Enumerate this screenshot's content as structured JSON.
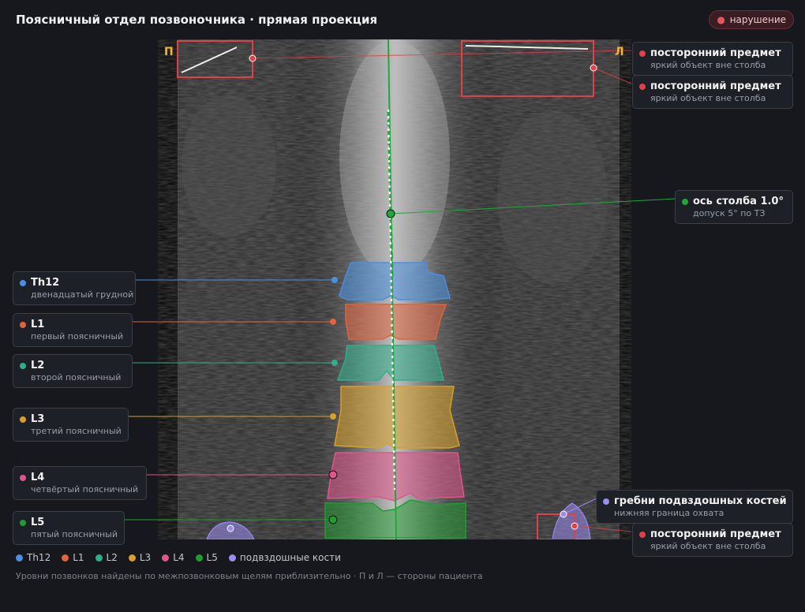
{
  "header": {
    "title": "Поясничный отдел позвоночника · прямая проекция",
    "badge": "нарушение"
  },
  "sides": {
    "right": "П",
    "left": "Л"
  },
  "colors": {
    "Th12": "#4a8fe0",
    "L1": "#e0643c",
    "L2": "#2fae8a",
    "L3": "#d8a028",
    "L4": "#e0558c",
    "L5": "#1e9e2e",
    "iliac": "#9b8cf0",
    "foreign": "#e0404a",
    "axis": "#1ea83a"
  },
  "foreign_objects": [
    {
      "name": "посторонний предмет",
      "sub": "яркий объект вне столба"
    },
    {
      "name": "посторонний предмет",
      "sub": "яркий объект вне столба"
    },
    {
      "name": "посторонний предмет",
      "sub": "яркий объект вне столба"
    }
  ],
  "axis": {
    "name": "ось столба 1.0°",
    "sub": "допуск 5° по ТЗ"
  },
  "iliac": {
    "name": "гребни подвздошных костей",
    "sub": "нижняя граница охвата"
  },
  "vertebrae": [
    {
      "key": "Th12",
      "name": "Th12",
      "sub": "двенадцатый грудной"
    },
    {
      "key": "L1",
      "name": "L1",
      "sub": "первый поясничный"
    },
    {
      "key": "L2",
      "name": "L2",
      "sub": "второй поясничный"
    },
    {
      "key": "L3",
      "name": "L3",
      "sub": "третий поясничный"
    },
    {
      "key": "L4",
      "name": "L4",
      "sub": "четвёртый поясничный"
    },
    {
      "key": "L5",
      "name": "L5",
      "sub": "пятый поясничный"
    }
  ],
  "legend": [
    "Th12",
    "L1",
    "L2",
    "L3",
    "L4",
    "L5",
    "подвздошные кости"
  ],
  "footnote": "Уровни позвонков найдены по межпозвонковым щелям приблизительно · П и Л — стороны пациента"
}
